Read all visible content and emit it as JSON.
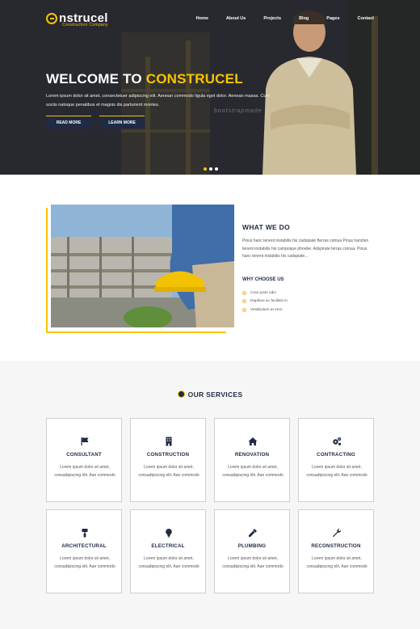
{
  "header": {
    "logo_name": "nstrucel",
    "logo_tagline": "Construction Company",
    "nav": [
      "Home",
      "About Us",
      "Projects",
      "Blog",
      "Pages",
      "Contact"
    ]
  },
  "hero": {
    "title_prefix": "WELCOME TO ",
    "title_accent": "CONSTRUCEL",
    "text": "Lorem ipsum dolor sit amet, consectetuer adipiscing elit. Aenean commodo ligula eget dolor. Aenean massa. Cum sociis natoque penatibus et magnis dis parturient montes.",
    "read_more": "READ MORE",
    "learn_more": "LEARN MORE",
    "slides": 3,
    "active_slide": 1,
    "watermark": "bootstrapmade"
  },
  "what_we_do": {
    "title": "WHAT WE DO",
    "description": "Pinus hanc tenent instabilis his cadspiate fterras comua Pinus hancten tenent instabilis his campoque phoebe. Adspirate terras comua. Pinus hanc tenent instabilis his cadspiate...",
    "why_title": "WHY CHOOSE US",
    "why_items": [
      "Cras justo odio",
      "Dapibus ac facilisis in",
      "Vestibulum at eros"
    ]
  },
  "services": {
    "title": "OUR SERVICES",
    "items": [
      {
        "title": "CONSULTANT",
        "icon": "flag-icon",
        "desc": "Lorem ipsum dolor sit amet, consadipiscing elit. Aan commodo"
      },
      {
        "title": "CONSTRUCTION",
        "icon": "building-icon",
        "desc": "Lorem ipsum dolor sit amet, consadipiscing elit. Aan commodo"
      },
      {
        "title": "RENOVATION",
        "icon": "home-icon",
        "desc": "Lorem ipsum dolor sit amet, consadipiscing elit. Aan commodo"
      },
      {
        "title": "CONTRACTING",
        "icon": "gears-icon",
        "desc": "Lorem ipsum dolor sit amet, consadipiscing elit. Aan commodo"
      },
      {
        "title": "ARCHITECTURAL",
        "icon": "paint-roller-icon",
        "desc": "Lorem ipsum dolor sit amet, consadipiscing elit. Aan commodo"
      },
      {
        "title": "ELECTRICAL",
        "icon": "lightbulb-icon",
        "desc": "Lorem ipsum dolor sit amet, consadipiscing elit. Aan commodo"
      },
      {
        "title": "PLUMBING",
        "icon": "eyedropper-icon",
        "desc": "Lorem ipsum dolor sit amet, consadipiscing elit. Aan commodo"
      },
      {
        "title": "RECONSTRUCTION",
        "icon": "wrench-icon",
        "desc": "Lorem ipsum dolor sit amet, consadipiscing elit. Aan commodo"
      }
    ]
  },
  "colors": {
    "accent": "#f7c500",
    "navy": "#1f2a44"
  }
}
